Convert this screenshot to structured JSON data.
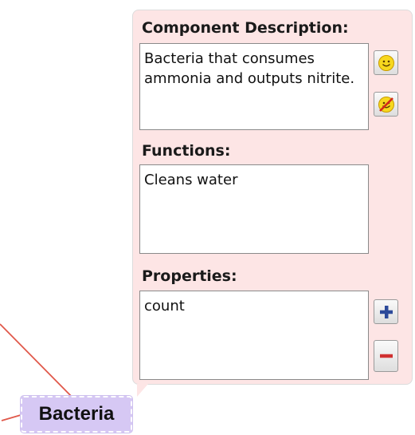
{
  "component_panel": {
    "description_label": "Component Description:",
    "description_text": "Bacteria that consumes ammonia and outputs nitrite.",
    "functions_label": "Functions:",
    "functions_text": "Cleans water",
    "properties_label": "Properties:",
    "properties_text": "count"
  },
  "node": {
    "label": "Bacteria"
  },
  "icons": [
    "smiley-icon",
    "smiley-disabled-icon",
    "plus-icon",
    "minus-icon"
  ],
  "colors": {
    "panel_bg": "#fde5e5",
    "node_bg": "#d6c8f4",
    "connector": "#e0584a",
    "plus": "#2d4a9a",
    "minus": "#d03030"
  }
}
